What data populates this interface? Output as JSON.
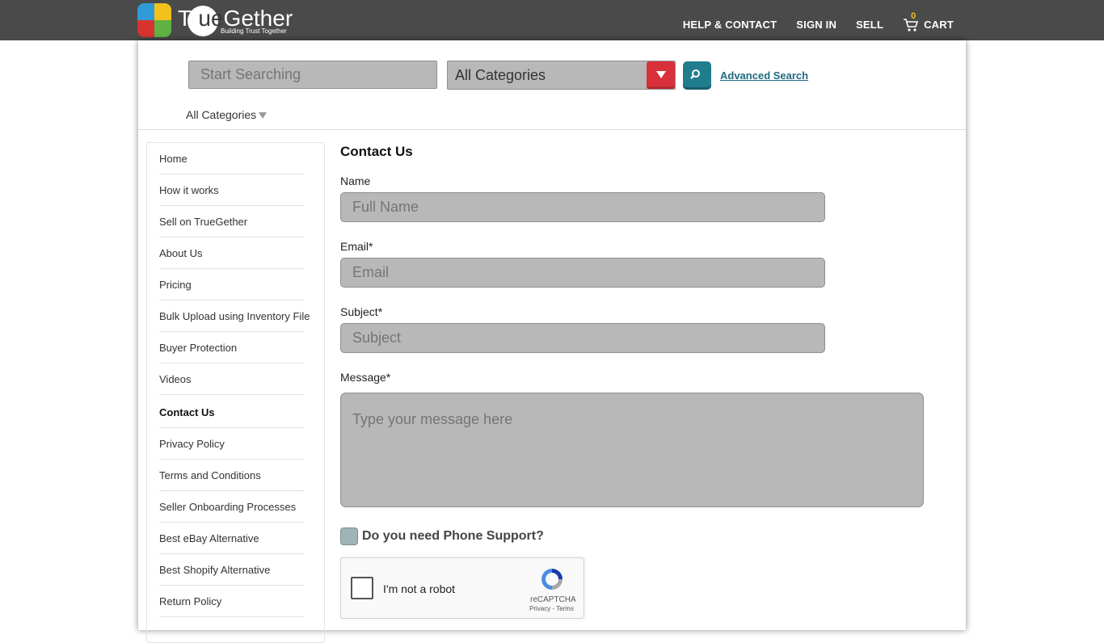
{
  "header": {
    "logo_prefix": "Tr",
    "logo_circle": "ue",
    "logo_suffix": "Gether",
    "logo_tagline": "Building Trust Together",
    "nav": {
      "help": "HELP & CONTACT",
      "signin": "SIGN IN",
      "sell": "SELL",
      "cart": "CART",
      "cart_count": "0"
    }
  },
  "search": {
    "placeholder": "Start Searching",
    "category_selected": "All Categories",
    "advanced_label": "Advanced Search",
    "category_toggle": "All Categories"
  },
  "sidebar": {
    "items": [
      {
        "label": "Home"
      },
      {
        "label": "How it works"
      },
      {
        "label": "Sell on TrueGether"
      },
      {
        "label": "About Us"
      },
      {
        "label": "Pricing"
      },
      {
        "label": "Bulk Upload using Inventory File"
      },
      {
        "label": "Buyer Protection"
      },
      {
        "label": "Videos"
      },
      {
        "label": "Contact Us"
      },
      {
        "label": "Privacy Policy"
      },
      {
        "label": "Terms and Conditions"
      },
      {
        "label": "Seller Onboarding Processes"
      },
      {
        "label": "Best eBay Alternative"
      },
      {
        "label": "Best Shopify Alternative"
      },
      {
        "label": "Return Policy"
      }
    ],
    "active": "Contact Us"
  },
  "form": {
    "title": "Contact Us",
    "name_label": "Name",
    "name_placeholder": "Full Name",
    "email_label": "Email*",
    "email_placeholder": "Email",
    "subject_label": "Subject*",
    "subject_placeholder": "Subject",
    "message_label": "Message*",
    "message_placeholder": "Type your message here",
    "phone_support_label": "Do you need Phone Support?",
    "recaptcha": {
      "label": "I'm not a robot",
      "brand": "reCAPTCHA",
      "links": "Privacy - Terms"
    }
  },
  "colors": {
    "header_bg": "#4a4a4a",
    "field_bg": "#b8b8b8",
    "dropdown_btn": "#d9313b",
    "search_btn": "#1f7d8e",
    "link": "#1f6b82"
  },
  "icons": {
    "search": "magnifier-icon",
    "cart": "shopping-cart-icon",
    "dropdown": "triangle-down-icon"
  }
}
